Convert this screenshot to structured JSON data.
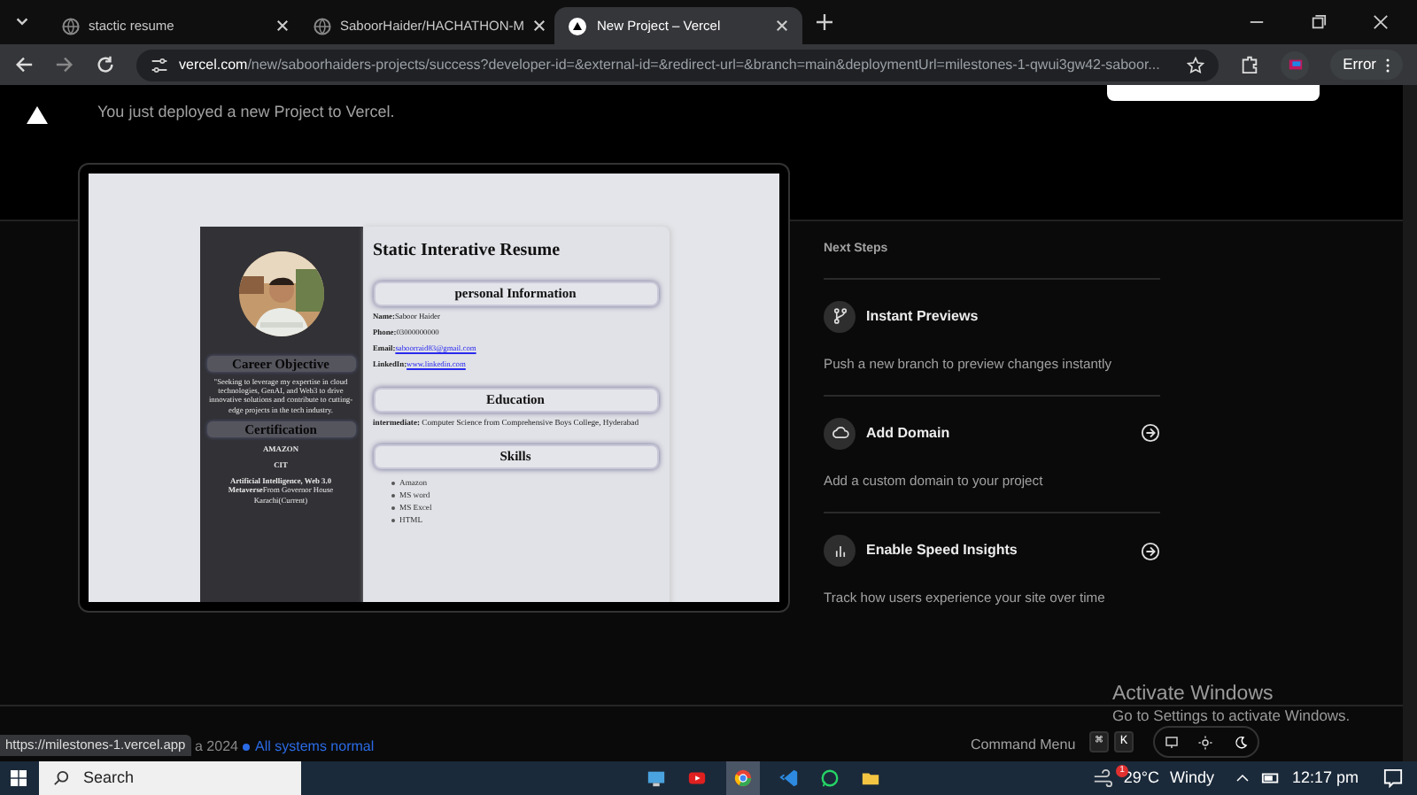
{
  "browser": {
    "tabs": [
      {
        "title": "stactic resume",
        "selected": false
      },
      {
        "title": "SaboorHaider/HACHATHON-M",
        "selected": false
      },
      {
        "title": "New Project – Vercel",
        "selected": true
      }
    ],
    "url_host": "vercel.com",
    "url_path": "/new/saboorhaiders-projects/success?developer-id=&external-id=&redirect-url=&branch=main&deploymentUrl=milestones-1-qwui3gw42-saboor...",
    "profile_button": "Error"
  },
  "page": {
    "message": "You just deployed a new Project to Vercel.",
    "preview": {
      "title": "Static Interative Resume",
      "sidebar": {
        "objective_heading": "Career Objective",
        "objective": "\"Seeking to leverage my expertise in cloud technologies, GenAI, and Web3 to drive innovative solutions and contribute to cutting-edge projects in the tech industry.",
        "certification_heading": "Certification",
        "certifications": [
          "**AMAZON**",
          "**CIT**",
          "**Artificial Intelligence, Web 3.0 Metaverse**From Governor House Karachi(Current)"
        ]
      },
      "sections": [
        {
          "heading": "personal Information",
          "kind": "fields",
          "fields": [
            {
              "label": "Name:",
              "value": "Saboor Haider",
              "link": false
            },
            {
              "label": "Phone:",
              "value": "03000000000",
              "link": false
            },
            {
              "label": "Email:",
              "value": "saboorraid83@gmail.com",
              "link": true
            },
            {
              "label": "LinkedIn:",
              "value": "www.linkedin.com",
              "link": true
            }
          ]
        },
        {
          "heading": "Education",
          "kind": "paragraph",
          "text": "**intermediate:** Computer Science from Comprehensive Boys College, Hyderabad"
        },
        {
          "heading": "Skills",
          "kind": "list",
          "items": [
            "Amazon",
            "MS word",
            "MS Excel",
            "HTML"
          ]
        }
      ]
    },
    "next_steps": {
      "title": "Next Steps",
      "items": [
        {
          "title": "Instant Previews",
          "description": "Push a new branch to preview changes instantly",
          "kind": "branch",
          "arrow": false
        },
        {
          "title": "Add Domain",
          "description": "Add a custom domain to your project",
          "kind": "cloud",
          "arrow": true
        },
        {
          "title": "Enable Speed Insights",
          "description": "Track how users experience your site over time",
          "kind": "chart",
          "arrow": true
        }
      ]
    },
    "footer": {
      "copyright": "a 2024",
      "status": "All systems normal",
      "command_menu": "Command Menu",
      "keys": [
        "⌘",
        "K"
      ]
    },
    "link_tooltip": "https://milestones-1.vercel.app"
  },
  "activation": {
    "title": "Activate Windows",
    "subtitle": "Go to Settings to activate Windows."
  },
  "taskbar": {
    "search": "Search",
    "weather": "29°C",
    "condition": "Windy",
    "time": "12:17 pm",
    "notification_count": "1"
  }
}
